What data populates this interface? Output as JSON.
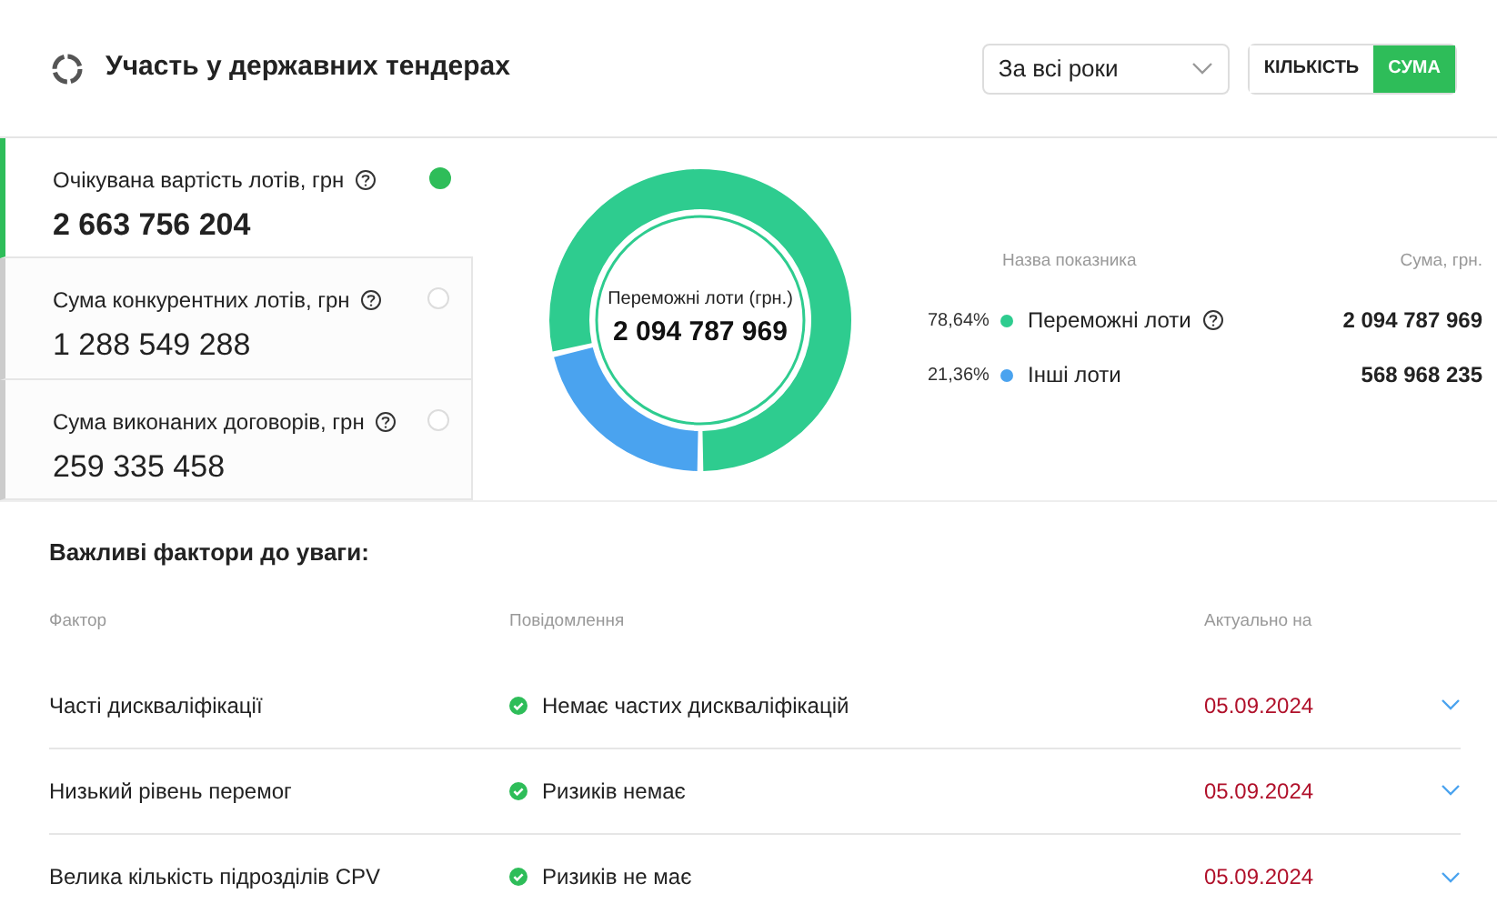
{
  "header": {
    "title": "Участь у державних тендерах",
    "period_select": {
      "value": "За всі роки"
    },
    "toggle": [
      {
        "label": "КІЛЬКІСТЬ",
        "selected": false
      },
      {
        "label": "СУМА",
        "selected": true
      }
    ]
  },
  "metric_cards": [
    {
      "label": "Очікувана вартість лотів, грн",
      "value": "2 663 756 204",
      "selected": true
    },
    {
      "label": "Сума конкурентних лотів, грн",
      "value": "1 288 549 288",
      "selected": false
    },
    {
      "label": "Сума виконаних договорів, грн",
      "value": "259 335 458",
      "selected": false
    }
  ],
  "donut": {
    "center_label": "Переможні лоти (грн.)",
    "center_value": "2 094 787 969",
    "chart_data": {
      "type": "donut",
      "categories": [
        "Переможні лоти",
        "Інші лоти"
      ],
      "values": [
        78.64,
        21.36
      ]
    }
  },
  "legend": {
    "columns": [
      "Назва показника",
      "Сума, грн."
    ],
    "rows": [
      {
        "percent": "78,64%",
        "info": true,
        "value": "2 094 787 969",
        "color": "#2ecc8f"
      },
      {
        "percent": "21,36%",
        "info": false,
        "value": "568 968 235",
        "color": "#4aa3ef"
      }
    ]
  },
  "factors": {
    "title": "Важливі фактори до уваги:",
    "columns": [
      "Фактор",
      "Повідомлення",
      "Актуально на"
    ],
    "rows": [
      {
        "factor": "Часті дискваліфікації",
        "message": "Немає частих дискваліфікацій",
        "date": "05.09.2024",
        "expanded": false
      },
      {
        "factor": "Низький рівень перемог",
        "message": "Ризиків немає",
        "date": "05.09.2024",
        "expanded": false
      },
      {
        "factor": "Велика кількість підрозділів CPV",
        "message": "Ризиків не має",
        "date": "05.09.2024",
        "expanded": false
      }
    ]
  }
}
